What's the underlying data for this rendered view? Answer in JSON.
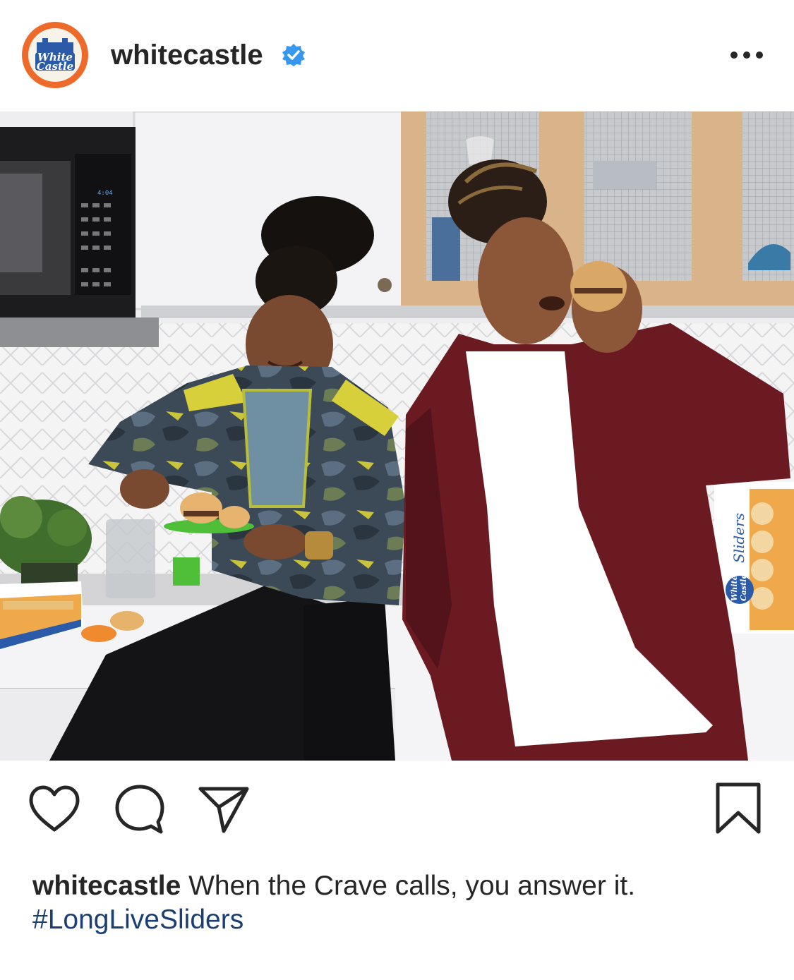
{
  "post": {
    "username": "whitecastle",
    "verified": true,
    "avatar_logo_text": [
      "White",
      "Castle"
    ],
    "more_icon": "more-horizontal-icon"
  },
  "photo": {
    "microwave_display": "4:04",
    "box_label": "Sliders",
    "box_brand": [
      "White",
      "Castle"
    ]
  },
  "actions": {
    "icons": [
      "heart-icon",
      "comment-icon",
      "share-icon",
      "bookmark-icon"
    ]
  },
  "caption": {
    "username": "whitecastle",
    "text": " When the Crave calls, you answer it.",
    "hashtag": "#LongLiveSliders"
  },
  "colors": {
    "brand_orange": "#ee6a2a",
    "verified_blue": "#3897f0",
    "hashtag_blue": "#1b3f73",
    "text": "#262626"
  }
}
